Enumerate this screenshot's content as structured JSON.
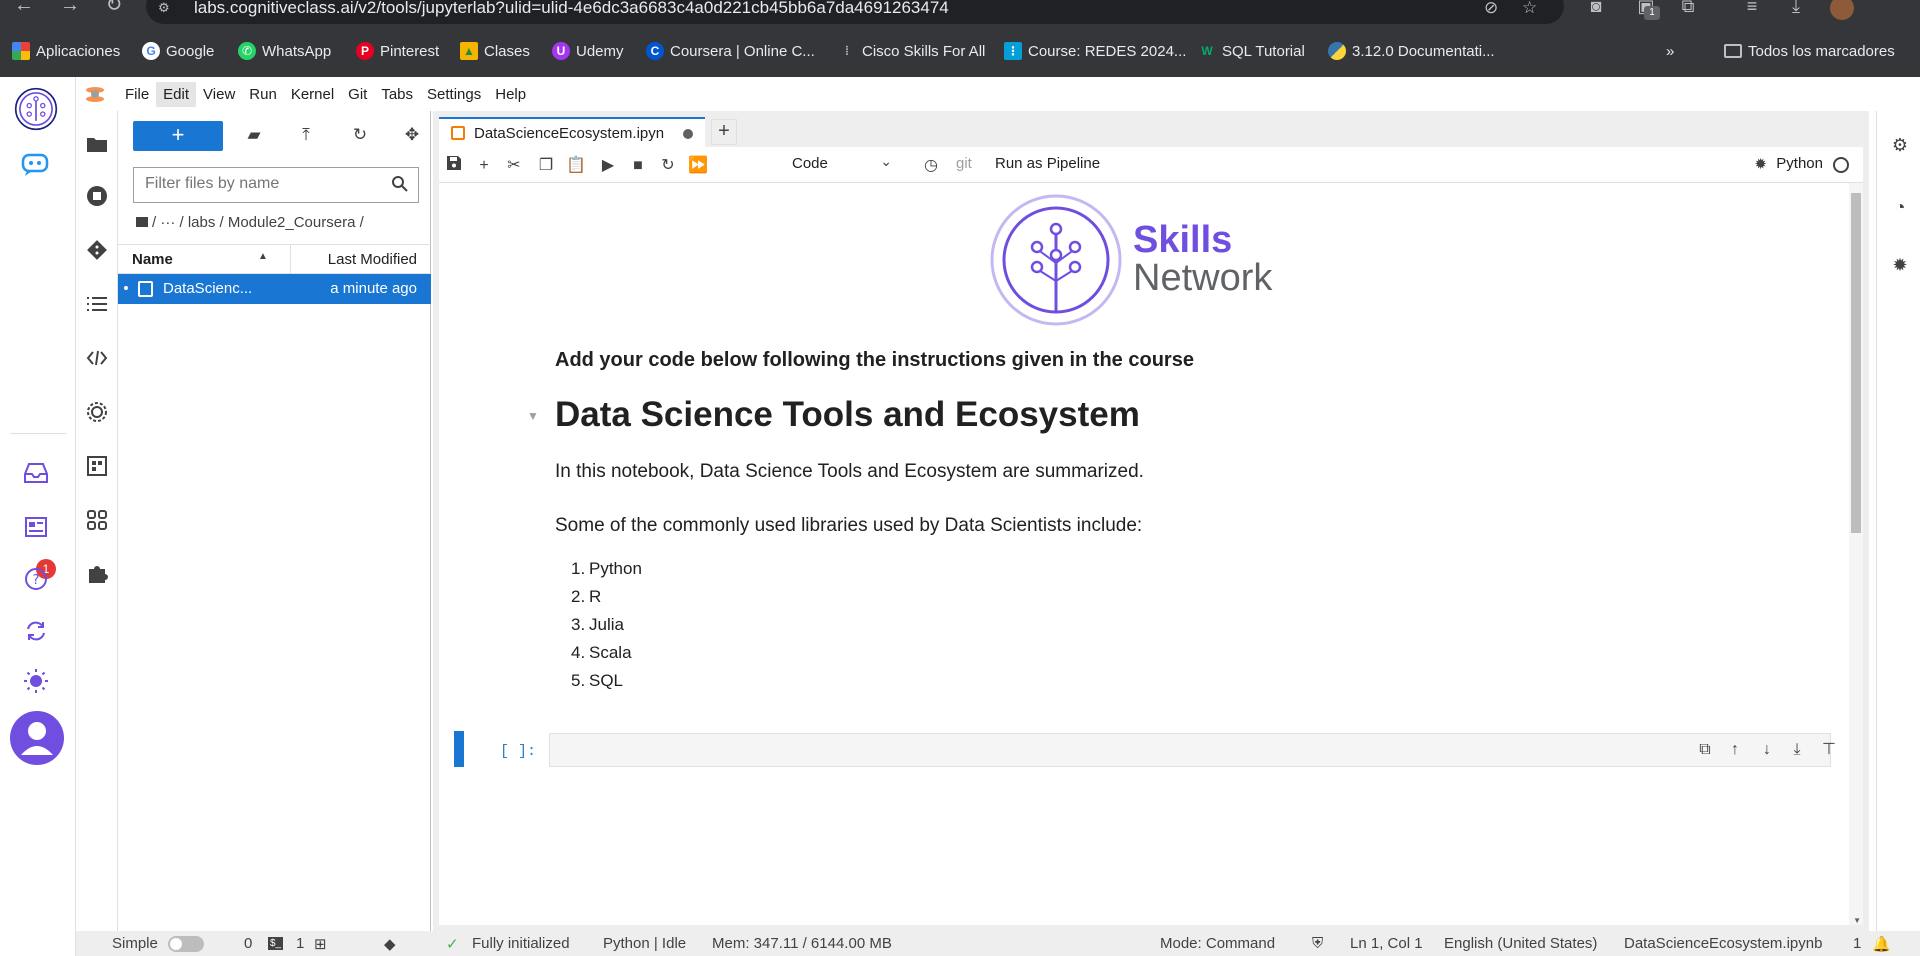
{
  "browser": {
    "url": "labs.cognitiveclass.ai/v2/tools/jupyterlab?ulid=ulid-4e6dc3a6683c4a0d221cb45bb6a7da4691263474",
    "bookmarks": [
      {
        "label": "Aplicaciones",
        "icon": "apps-grid-icon",
        "color": "#ea4335"
      },
      {
        "label": "Google",
        "icon": "google-icon",
        "color": "#4285f4"
      },
      {
        "label": "WhatsApp",
        "icon": "whatsapp-icon",
        "color": "#25d366"
      },
      {
        "label": "Pinterest",
        "icon": "pinterest-icon",
        "color": "#e60023"
      },
      {
        "label": "Clases",
        "icon": "classroom-icon",
        "color": "#f4b400"
      },
      {
        "label": "Udemy",
        "icon": "udemy-icon",
        "color": "#a435f0"
      },
      {
        "label": "Coursera | Online C...",
        "icon": "coursera-icon",
        "color": "#0056d2"
      },
      {
        "label": "Cisco Skills For All",
        "icon": "cisco-icon",
        "color": "#5f6368"
      },
      {
        "label": "Course: REDES 2024...",
        "icon": "cisco-netacad-icon",
        "color": "#049fd9"
      },
      {
        "label": "SQL Tutorial",
        "icon": "w3schools-icon",
        "color": "#04aa6d"
      },
      {
        "label": "3.12.0 Documentati...",
        "icon": "python-icon",
        "color": "#3776ab"
      }
    ],
    "all_bookmarks": "Todos los marcadores",
    "ext_badge": "1"
  },
  "lab": {
    "menu": [
      "File",
      "Edit",
      "View",
      "Run",
      "Kernel",
      "Git",
      "Tabs",
      "Settings",
      "Help"
    ],
    "active_menu": "Edit",
    "mail_badge": "1",
    "filebrowser": {
      "new_label": "+",
      "filter_placeholder": "Filter files by name",
      "breadcrumb": "/   ···   / labs / Module2_Coursera /",
      "col_name": "Name",
      "col_modified": "Last Modified",
      "row_name": "DataScienc...",
      "row_modified": "a minute ago"
    },
    "tab": {
      "label": "DataScienceEcosystem.ipyn",
      "add": "+"
    },
    "toolbar": {
      "cell_type": "Code",
      "git": "git",
      "pipeline": "Run as Pipeline",
      "kernel": "Python"
    },
    "notebook": {
      "logo_skills": "Skills",
      "logo_network": "Network",
      "intro": "Add your code below following the instructions given in the course",
      "heading": "Data Science Tools and Ecosystem",
      "p1": "In this notebook, Data Science Tools and Ecosystem are summarized.",
      "p2": "Some of the commonly used libraries used by Data Scientists include:",
      "list": [
        {
          "num": "1.",
          "text": "Python"
        },
        {
          "num": "2.",
          "text": "R"
        },
        {
          "num": "3.",
          "text": "Julia"
        },
        {
          "num": "4.",
          "text": "Scala"
        },
        {
          "num": "5.",
          "text": "SQL"
        }
      ],
      "prompt": "[ ]:"
    },
    "status": {
      "mode_label": "Simple",
      "count0": "0",
      "count1": "1",
      "initialized": "Fully initialized",
      "kernel": "Python | Idle",
      "mem": "Mem: 347.11 / 6144.00 MB",
      "mode": "Mode: Command",
      "position": "Ln 1, Col 1",
      "language": "English (United States)",
      "filename": "DataScienceEcosystem.ipynb",
      "notif_count": "1"
    }
  }
}
